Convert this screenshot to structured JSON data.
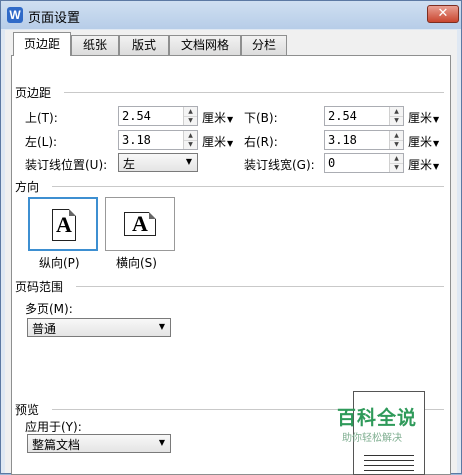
{
  "window": {
    "title": "页面设置",
    "app_icon_letter": "W",
    "close_glyph": "✕"
  },
  "tabs": [
    {
      "label": "页边距",
      "active": true
    },
    {
      "label": "纸张",
      "active": false
    },
    {
      "label": "版式",
      "active": false
    },
    {
      "label": "文档网格",
      "active": false
    },
    {
      "label": "分栏",
      "active": false
    }
  ],
  "margins": {
    "section_title": "页边距",
    "top": {
      "label": "上(T):",
      "value": "2.54",
      "unit": "厘米"
    },
    "bottom": {
      "label": "下(B):",
      "value": "2.54",
      "unit": "厘米"
    },
    "left": {
      "label": "左(L):",
      "value": "3.18",
      "unit": "厘米"
    },
    "right": {
      "label": "右(R):",
      "value": "3.18",
      "unit": "厘米"
    },
    "gutter_position": {
      "label": "装订线位置(U):",
      "value": "左"
    },
    "gutter_width": {
      "label": "装订线宽(G):",
      "value": "0",
      "unit": "厘米"
    }
  },
  "orientation": {
    "section_title": "方向",
    "portrait": {
      "label": "纵向(P)",
      "glyph": "A",
      "selected": true
    },
    "landscape": {
      "label": "横向(S)",
      "glyph": "A",
      "selected": false
    }
  },
  "pages": {
    "section_title": "页码范围",
    "multiple_label": "多页(M):",
    "multiple_value": "普通"
  },
  "preview": {
    "section_title": "预览",
    "apply_label": "应用于(Y):",
    "apply_value": "整篇文档"
  },
  "watermark": {
    "title": "百科全说",
    "subtitle": "助你轻松解决"
  },
  "colors": {
    "selection": "#3d8fd1",
    "watermark": "#2f9a5a",
    "close": "#c9462f"
  }
}
